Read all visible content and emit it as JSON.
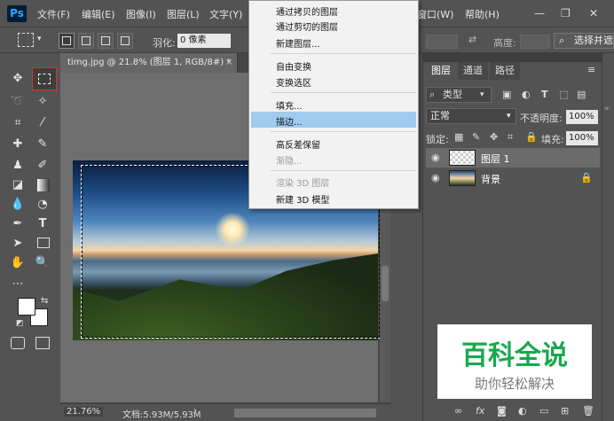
{
  "app": {
    "logo": "Ps"
  },
  "menubar": {
    "items": [
      "文件(F)",
      "编辑(E)",
      "图像(I)",
      "图层(L)",
      "文字(Y)"
    ],
    "window_item": "窗口(W)",
    "help_item": "帮助(H)",
    "minimize": "—",
    "restore": "❐",
    "close": "✕"
  },
  "options": {
    "feather_label": "羽化:",
    "feather_value": "0 像素",
    "height_label": "高度:",
    "select_mask_label": "选择并遮"
  },
  "document": {
    "tab_title": "timg.jpg @ 21.8% (图层 1, RGB/8#) *",
    "tab_close": "×",
    "zoom": "21.76%",
    "doc_info": "文档:5.93M/5.93M"
  },
  "context_menu": {
    "items": [
      {
        "label": "通过拷贝的图层",
        "disabled": false
      },
      {
        "label": "通过剪切的图层",
        "disabled": false
      },
      {
        "label": "新建图层...",
        "disabled": false
      },
      {
        "label": "自由变换",
        "disabled": false
      },
      {
        "label": "变换选区",
        "disabled": false
      },
      {
        "label": "填充...",
        "disabled": false
      },
      {
        "label": "描边...",
        "disabled": false,
        "highlighted": true
      },
      {
        "label": "高反差保留",
        "disabled": false
      },
      {
        "label": "渐隐...",
        "disabled": true
      },
      {
        "label": "渲染 3D 图层",
        "disabled": true
      },
      {
        "label": "新建 3D 模型",
        "disabled": false
      }
    ]
  },
  "layers_panel": {
    "tabs": [
      "图层",
      "通道",
      "路径"
    ],
    "active_tab": "图层",
    "filter_kind": "类型",
    "blend_mode": "正常",
    "opacity_label": "不透明度:",
    "opacity_value": "100%",
    "lock_label": "锁定:",
    "fill_label": "填充:",
    "fill_value": "100%",
    "layers": [
      {
        "name": "图层 1",
        "selected": true,
        "locked": false
      },
      {
        "name": "背景",
        "selected": false,
        "locked": true
      }
    ]
  },
  "watermark": {
    "title": "百科全说",
    "subtitle": "助你轻松解决"
  },
  "colors": {
    "accent_highlight": "#9fcbef",
    "watermark_green": "#1aa84f",
    "ps_blue": "#31a8ff"
  }
}
